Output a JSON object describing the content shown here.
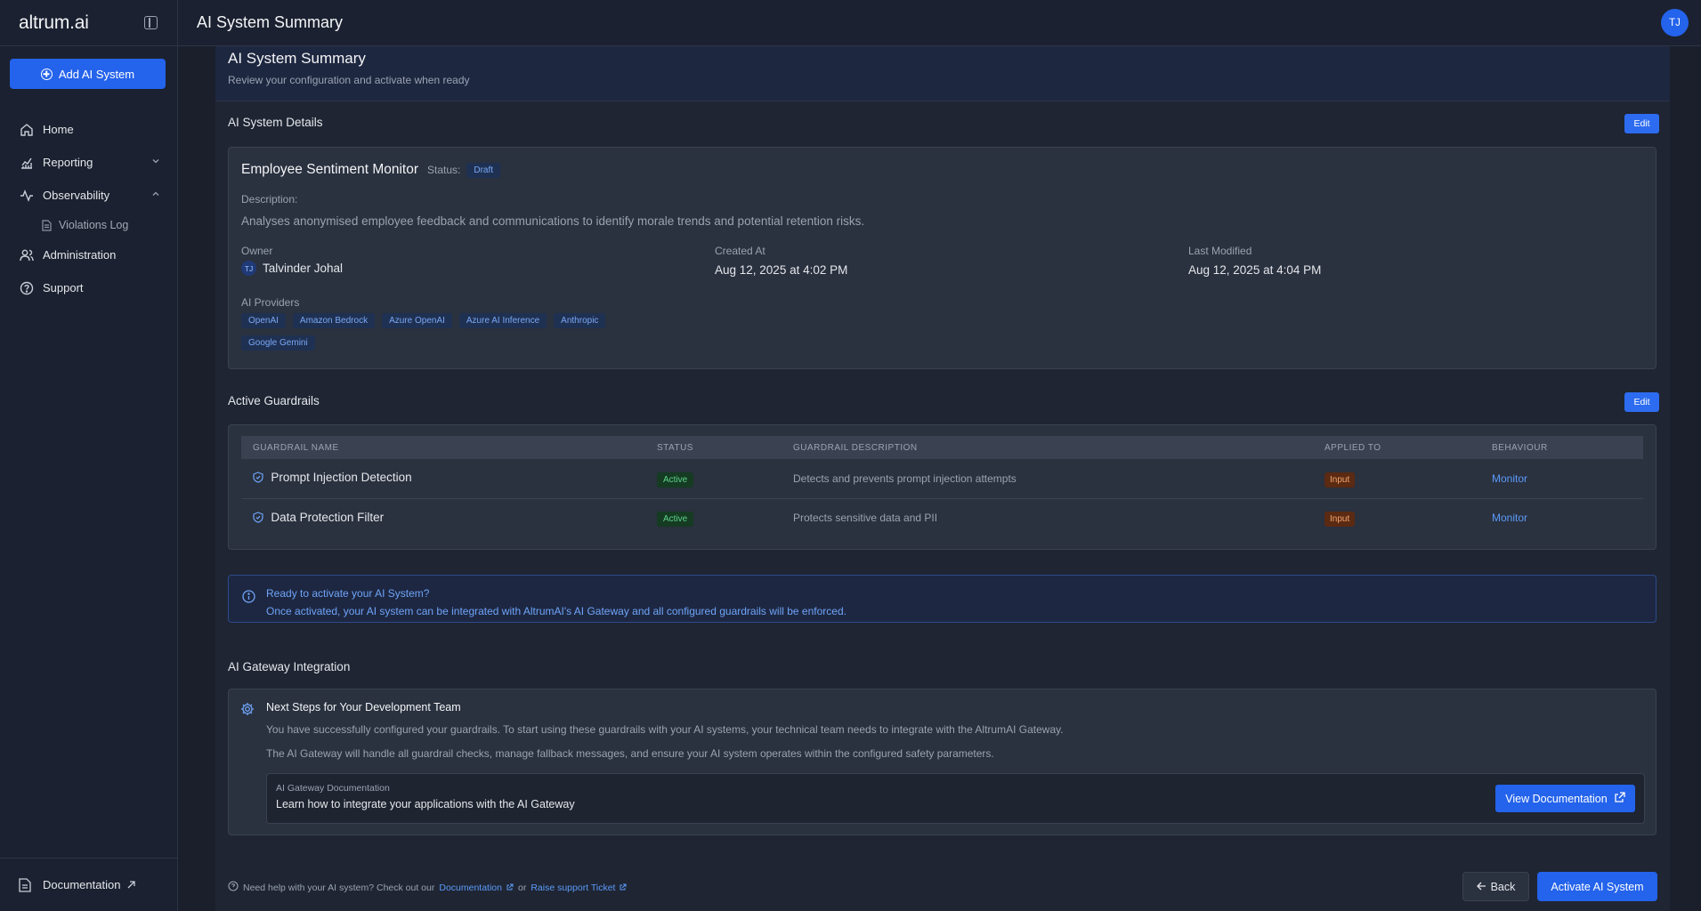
{
  "app": {
    "logo": "altrum.ai"
  },
  "sidebar": {
    "add_button": "Add AI System",
    "items": [
      {
        "label": "Home",
        "icon": "home-icon"
      },
      {
        "label": "Reporting",
        "icon": "chart-icon"
      },
      {
        "label": "Observability",
        "icon": "activity-icon"
      },
      {
        "label": "Violations Log",
        "icon": "document-icon"
      },
      {
        "label": "Administration",
        "icon": "users-icon"
      },
      {
        "label": "Support",
        "icon": "help-circle-icon"
      }
    ],
    "documentation": "Documentation"
  },
  "topbar": {
    "title": "AI System Summary",
    "avatar": "TJ"
  },
  "header": {
    "title": "AI System Summary",
    "subtitle": "Review your configuration and activate when ready"
  },
  "details": {
    "section_title": "AI System Details",
    "edit": "Edit",
    "name": "Employee Sentiment Monitor",
    "status_label": "Status:",
    "status": "Draft",
    "description_label": "Description:",
    "description": "Analyses anonymised employee feedback and communications to identify morale trends and potential retention risks.",
    "owner_label": "Owner",
    "owner_initials": "TJ",
    "owner": "Talvinder Johal",
    "created_label": "Created At",
    "created": "Aug 12, 2025 at 4:02 PM",
    "modified_label": "Last Modified",
    "modified": "Aug 12, 2025 at 4:04 PM",
    "providers_label": "AI Providers",
    "providers": [
      "OpenAI",
      "Amazon Bedrock",
      "Azure OpenAI",
      "Azure AI Inference",
      "Anthropic",
      "Google Gemini"
    ]
  },
  "guardrails": {
    "section_title": "Active Guardrails",
    "edit": "Edit",
    "columns": [
      "GUARDRAIL NAME",
      "STATUS",
      "GUARDRAIL DESCRIPTION",
      "APPLIED TO",
      "BEHAVIOUR"
    ],
    "rows": [
      {
        "name": "Prompt Injection Detection",
        "status": "Active",
        "description": "Detects and prevents prompt injection attempts",
        "applied_to": "Input",
        "behaviour": "Monitor"
      },
      {
        "name": "Data Protection Filter",
        "status": "Active",
        "description": "Protects sensitive data and PII",
        "applied_to": "Input",
        "behaviour": "Monitor"
      }
    ]
  },
  "info": {
    "title": "Ready to activate your AI System?",
    "text": "Once activated, your AI system can be integrated with AltrumAI's AI Gateway and all configured guardrails will be enforced."
  },
  "gateway": {
    "section_title": "AI Gateway Integration",
    "heading": "Next Steps for Your Development Team",
    "p1": "You have successfully configured your guardrails. To start using these guardrails with your AI systems, your technical team needs to integrate with the AltrumAI Gateway.",
    "p2": "The AI Gateway will handle all guardrail checks, manage fallback messages, and ensure your AI system operates within the configured safety parameters.",
    "doc_label": "AI Gateway Documentation",
    "doc_text": "Learn how to integrate your applications with the AI Gateway",
    "view_button": "View Documentation"
  },
  "footer": {
    "help_text": "Need help with your AI system? Check out our",
    "documentation_link": "Documentation",
    "or": "or",
    "support_link": "Raise support Ticket",
    "back": "Back",
    "activate": "Activate AI System"
  }
}
